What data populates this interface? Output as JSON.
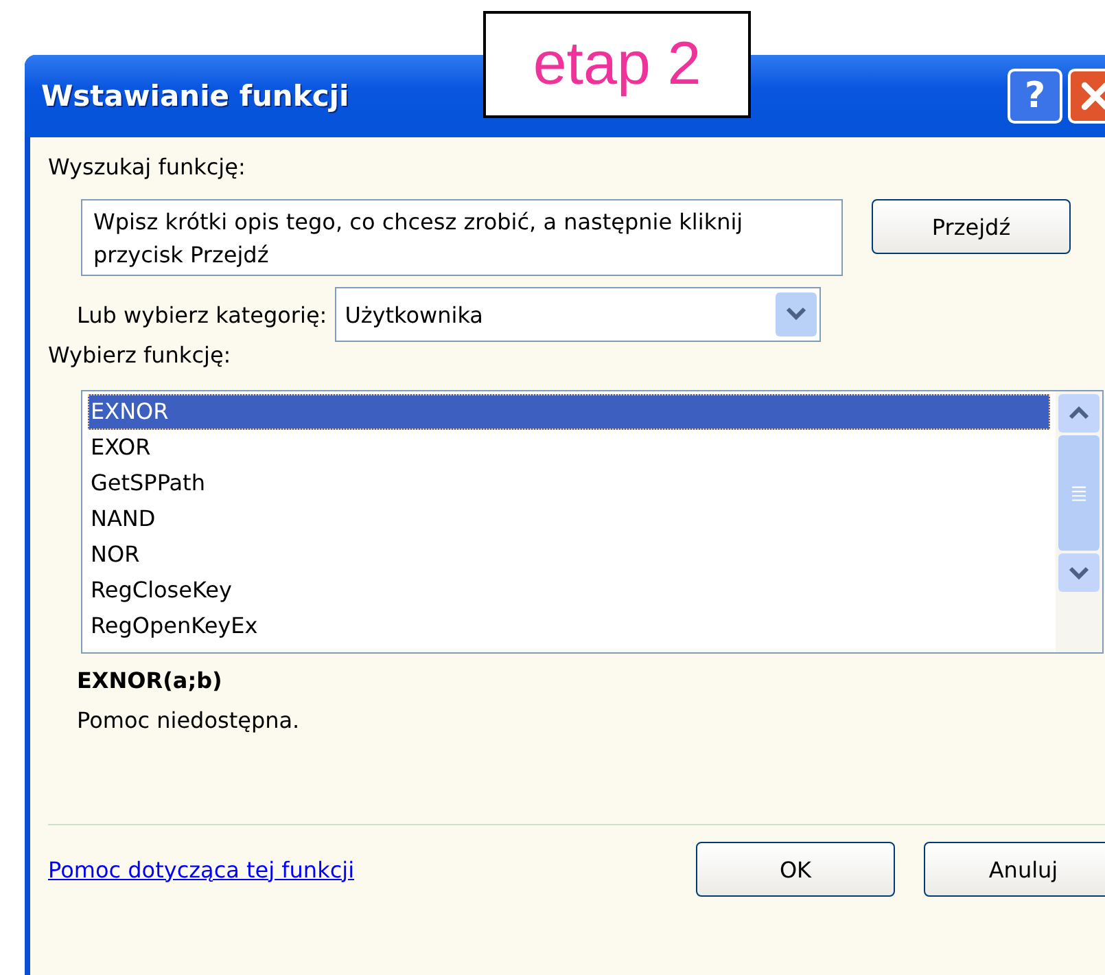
{
  "overlay_label": "etap 2",
  "window": {
    "title": "Wstawianie funkcji",
    "buttons": [
      "?"
    ]
  },
  "search": {
    "label": "Wyszukaj funkcję:",
    "value": "Wpisz krótki opis tego, co chcesz zrobić, a następnie kliknij przycisk Przejdź",
    "button": "Przejdź"
  },
  "category": {
    "label": "Lub wybierz kategorię:",
    "value": "Użytkownika"
  },
  "functions": {
    "label": "Wybierz funkcję:",
    "items": [
      {
        "name": "EXNOR",
        "selected": true
      },
      {
        "name": "EXOR",
        "selected": false
      },
      {
        "name": "GetSPPath",
        "selected": false
      },
      {
        "name": "NAND",
        "selected": false
      },
      {
        "name": "NOR",
        "selected": false
      },
      {
        "name": "RegCloseKey",
        "selected": false
      },
      {
        "name": "RegOpenKeyEx",
        "selected": false
      }
    ]
  },
  "signature": "EXNOR(a;b)",
  "description": "Pomoc niedostępna.",
  "help_link": "Pomoc dotycząca tej funkcji",
  "buttons": [
    "OK",
    "Anuluj"
  ]
}
